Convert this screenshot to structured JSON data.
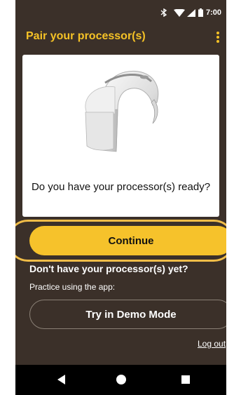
{
  "status_bar": {
    "time": "7:00",
    "icons": [
      "bluetooth-icon",
      "wifi-icon",
      "signal-icon",
      "battery-icon"
    ]
  },
  "app_bar": {
    "title": "Pair your processor(s)",
    "menu_icon": "overflow-menu-icon"
  },
  "card": {
    "image": "sound-processor-image",
    "question": "Do you have your processor(s) ready?"
  },
  "actions": {
    "continue_label": "Continue",
    "no_processor_text": "Don't have your processor(s) yet?",
    "practice_text": "Practice using the app:",
    "demo_label": "Try in Demo Mode",
    "logout_label": "Log out"
  },
  "nav_bar": {
    "icons": [
      "back-icon",
      "home-icon",
      "recents-icon"
    ]
  },
  "colors": {
    "background": "#3b3029",
    "accent": "#f6c22b",
    "highlight_ring": "#f1bd48",
    "card": "#ffffff",
    "nav_bar": "#000000"
  }
}
